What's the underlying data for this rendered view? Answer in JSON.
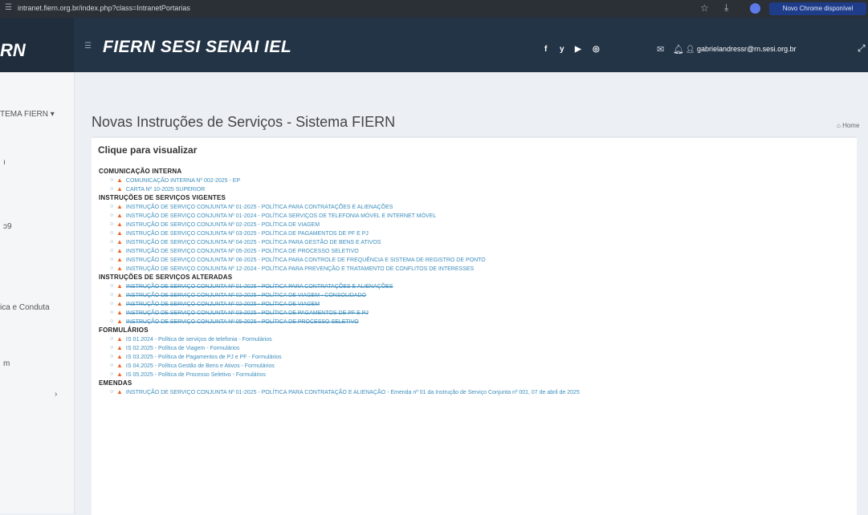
{
  "browser": {
    "url": "intranet.fiern.org.br/index.php?class=IntranetPortarias",
    "update_label": "Novo Chrome disponível"
  },
  "header": {
    "logo_fragment": "RN",
    "brand": "FIERN SESI SENAI IEL",
    "social": [
      "f",
      "y",
      "▶",
      "◎"
    ],
    "user_email": "gabrielandressr@rn.sesi.org.br"
  },
  "sidebar": {
    "items": [
      "TEMA FIERN ▾",
      "ica e Conduta"
    ]
  },
  "main": {
    "title": "Novas Instruções de Serviços - Sistema FIERN",
    "breadcrumb": "Home",
    "box_title": "Clique para visualizar"
  },
  "sections": [
    {
      "title": "COMUNICAÇÃO INTERNA",
      "strike": false,
      "items": [
        "COMUNICAÇÃO INTERNA Nº 002-2025 - EP",
        "CARTA Nº 10-2025 SUPERIOR"
      ]
    },
    {
      "title": "INSTRUÇÕES DE SERVIÇOS VIGENTES",
      "strike": false,
      "items": [
        "INSTRUÇÃO DE SERVIÇO CONJUNTA Nº 01-2025 - POLÍTICA PARA CONTRATAÇÕES E ALIENAÇÕES",
        "INSTRUÇÃO DE SERVIÇO CONJUNTA Nº 01-2024 - POLÍTICA SERVIÇOS DE TELEFONIA MÓVEL E INTERNET MÓVEL",
        "INSTRUÇÃO DE SERVIÇO CONJUNTA Nº 02-2025 - POLÍTICA DE VIAGEM",
        "INSTRUÇÃO DE SERVIÇO CONJUNTA Nº 03-2025 - POLÍTICA DE PAGAMENTOS DE PF E PJ",
        "INSTRUÇÃO DE SERVIÇO CONJUNTA Nº 04-2025 - POLÍTICA PARA GESTÃO DE BENS E ATIVOS",
        "INSTRUÇÃO DE SERVIÇO CONJUNTA Nº 05-2025 - POLÍTICA DE PROCESSO SELETIVO",
        "INSTRUÇÃO DE SERVIÇO CONJUNTA Nº 06-2025 - POLÍTICA PARA CONTROLE DE FREQUÊNCIA E SISTEMA DE REGISTRO DE PONTO",
        "INSTRUÇÃO DE SERVIÇO CONJUNTA Nº 12-2024 - POLÍTICA PARA PREVENÇÃO E TRATAMENTO DE CONFLITOS DE INTERESSES"
      ]
    },
    {
      "title": "INSTRUÇÕES DE SERVIÇOS ALTERADAS",
      "strike": true,
      "items": [
        "INSTRUÇÃO DE SERVIÇO CONJUNTA Nº 01-2025 - POLÍTICA PARA CONTRATAÇÕES E ALIENAÇÕES",
        "INSTRUÇÃO DE SERVIÇO CONJUNTA Nº 02-2025 - POLÍTICA DE VIAGEM - CONSOLIDADO",
        "INSTRUÇÃO DE SERVIÇO CONJUNTA Nº 02-2025 - POLÍTICA DE VIAGEM",
        "INSTRUÇÃO DE SERVIÇO CONJUNTA Nº 03-2025 - POLÍTICA DE PAGAMENTOS DE PF E PJ",
        "INSTRUÇÃO DE SERVIÇO CONJUNTA Nº 05-2025 - POLÍTICA DE PROCESSO SELETIVO"
      ]
    },
    {
      "title": "FORMULÁRIOS",
      "strike": false,
      "items": [
        "IS 01.2024 - Política de serviços de telefonia - Formulários",
        "IS 02.2025 - Política de Viagem - Formulários",
        "IS 03.2025 - Política de Pagamentos de PJ e PF - Formulários",
        "IS 04.2025 - Política Gestão de Bens e Ativos - Formulários",
        "IS 05.2025 - Política de Processo Seletivo - Formulários"
      ]
    },
    {
      "title": "EMENDAS",
      "strike": false,
      "items": [
        "INSTRUÇÃO DE SERVIÇO CONJUNTA Nº 01-2025 - POLÍTICA PARA CONTRATAÇÃO E ALIENAÇÃO - Emenda nº 01 da Instrução de Serviço Conjunta nº 001, 07 de abril de 2025"
      ]
    }
  ]
}
